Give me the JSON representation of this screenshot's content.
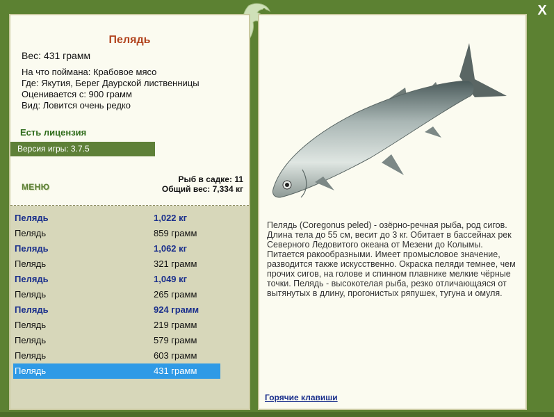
{
  "window": {
    "close_label": "X"
  },
  "fish": {
    "name": "Пелядь",
    "weight_label": "Вес: 431 грамм",
    "info_lines": [
      "На что поймана: Крабовое мясо",
      "Где: Якутия, Берег Даурской лиственницы",
      "Оценивается с: 900 грамм",
      "Вид: Ловится очень редко"
    ],
    "license": "Есть лицензия",
    "description": "Пелядь (Coregonus peled) - озёрно-речная рыба, род сигов. Длина тела до 55 см, весит до 3 кг. Обитает в бассейнах рек Северного Ледовитого океана от Мезени до Колымы. Питается ракообразными. Имеет промысловое значение, разводится также искусственно. Окраска пеляди темнее, чем прочих сигов, на голове и спинном плавнике мелкие чёрные точки. Пелядь - высокотелая рыба, резко отличающаяся от вытянутых в длину, прогонистых ряпушек, тугуна и омуля."
  },
  "version_label": "Версия игры: 3.7.5",
  "menu_label": "МЕНЮ",
  "stats": {
    "count_line": "Рыб в садке: 11",
    "total_line": "Общий вес: 7,334 кг"
  },
  "catch_list": [
    {
      "name": "Пелядь",
      "weight": "1,022 кг",
      "bold": true
    },
    {
      "name": "Пелядь",
      "weight": "859 грамм",
      "bold": false
    },
    {
      "name": "Пелядь",
      "weight": "1,062 кг",
      "bold": true
    },
    {
      "name": "Пелядь",
      "weight": "321 грамм",
      "bold": false
    },
    {
      "name": "Пелядь",
      "weight": "1,049 кг",
      "bold": true
    },
    {
      "name": "Пелядь",
      "weight": "265 грамм",
      "bold": false
    },
    {
      "name": "Пелядь",
      "weight": "924 грамм",
      "bold": true
    },
    {
      "name": "Пелядь",
      "weight": "219 грамм",
      "bold": false
    },
    {
      "name": "Пелядь",
      "weight": "579 грамм",
      "bold": false
    },
    {
      "name": "Пелядь",
      "weight": "603 грамм",
      "bold": false
    },
    {
      "name": "Пелядь",
      "weight": "431 грамм",
      "bold": false,
      "selected": true
    }
  ],
  "hotkeys_label": "Горячие клавиши",
  "colors": {
    "frame": "#5c8132",
    "title": "#b2451f",
    "selection": "#2f9ae6",
    "bold_entry": "#1a2f8c"
  }
}
